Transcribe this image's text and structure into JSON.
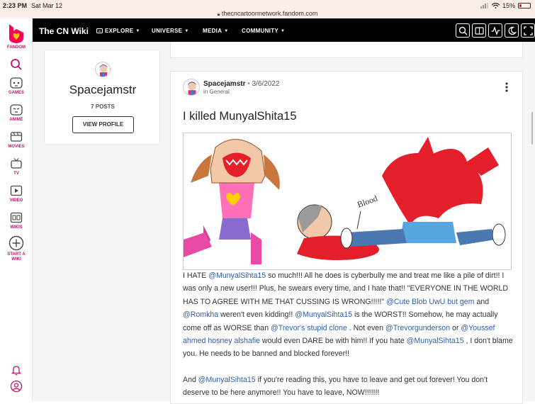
{
  "status_bar": {
    "time": "2:23 PM",
    "date": "Sat Mar 12",
    "url": "thecncartoonnetwork.fandom.com",
    "battery": "15%"
  },
  "sidebar": {
    "logo_label": "FANDOM",
    "items": [
      {
        "label": "GAMES",
        "icon": "gamepad-icon"
      },
      {
        "label": "ANIME",
        "icon": "anime-icon"
      },
      {
        "label": "MOVIES",
        "icon": "clapperboard-icon"
      },
      {
        "label": "TV",
        "icon": "tv-icon"
      },
      {
        "label": "VIDEO",
        "icon": "video-icon"
      },
      {
        "label": "WIKIS",
        "icon": "wikis-icon"
      },
      {
        "label_line1": "START A",
        "label_line2": "WIKI",
        "icon": "plus-circle-icon"
      }
    ]
  },
  "topnav": {
    "wiki_name": "The CN Wiki",
    "explore": "EXPLORE",
    "universe": "UNIVERSE",
    "media": "MEDIA",
    "community": "COMMUNITY"
  },
  "profile": {
    "username": "Spacejamstr",
    "posts": "7 POSTS",
    "view_profile": "VIEW PROFILE"
  },
  "post": {
    "author": "Spacejamstr",
    "separator": "•",
    "date": "3/6/2022",
    "category": "in General",
    "title": "I killed MunyalShita15",
    "image_label": "Blood",
    "body": {
      "t1": "I HATE ",
      "m1": "@MunyalSihta15",
      "t2": " so much!!! All he does is cyberbully me and treat me like a pile of dirt!! I was only a new user!!! Plus, he swears every time, and I hate that!! \"EVERYONE IN THE WORLD HAS TO AGREE WITH ME THAT CUSSING IS WRONG!!!!!\" ",
      "m2": "@Cute Blob UwU but gem",
      "t3": " and ",
      "m3": "@Romkha",
      "t4": " weren't even kidding!! ",
      "m4": "@MunyalSihta15",
      "t5": " is the WORST!! Somehow, he may actually come off as WORSE than ",
      "m5": "@Trevor's stupid clone",
      "t6": " . Not even ",
      "m6": "@Trevorgunderson",
      "t7": " or ",
      "m7": "@Youssef ahmed hosney alshafie",
      "t8": " would even DARE be with him!! If you hate ",
      "m8": "@MunyalSihta15",
      "t9": " , I don't blame you. He needs to be banned and blocked forever!!",
      "p2_t1": "And ",
      "p2_m1": "@MunyalSihta15",
      "p2_t2": " if you're reading this, you have to leave and get out forever! You don't deserve to be here anymore!! You have to leave, NOW!!!!!!!"
    }
  },
  "colors": {
    "brand": "#c0136e",
    "nav_bg": "#000000",
    "link": "#2f5fb0",
    "page_bg": "#f5f5f5"
  }
}
